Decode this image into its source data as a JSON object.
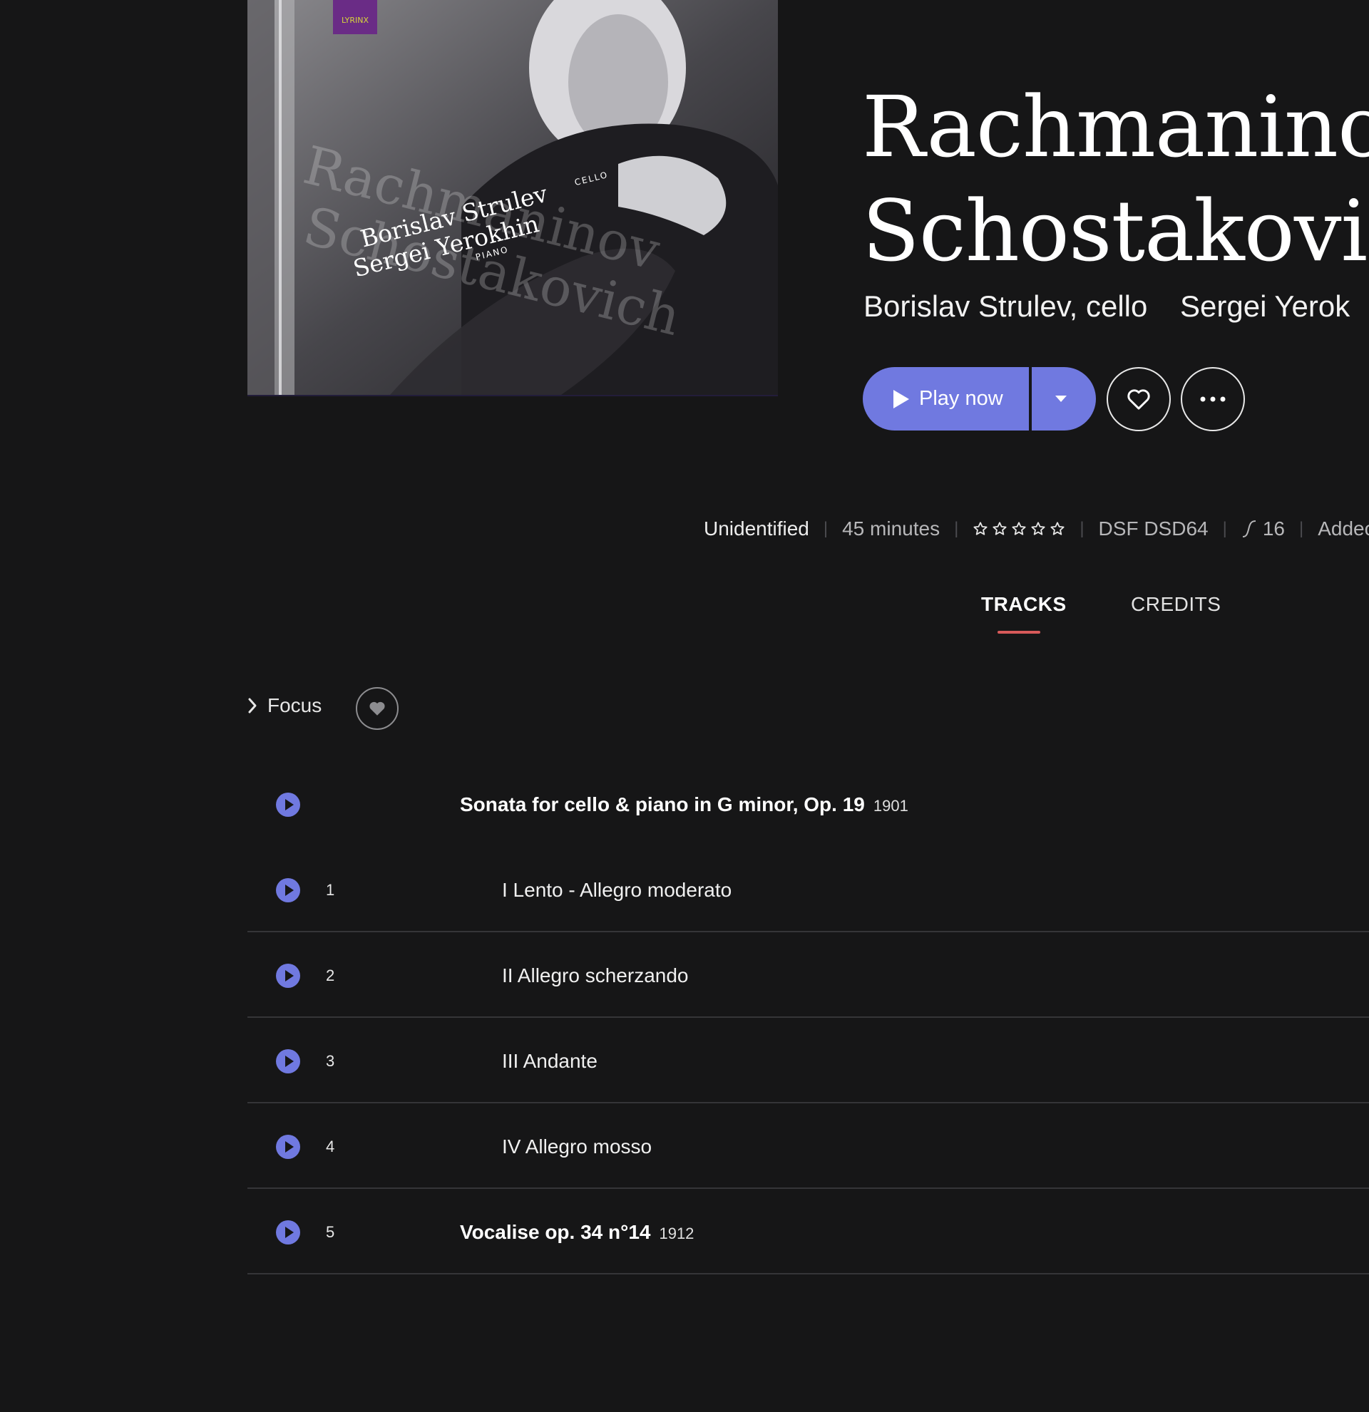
{
  "album": {
    "title_line1": "Rachmaninov",
    "title_line2": "Schostakovich",
    "artists": [
      "Borislav Strulev, cello",
      "Sergei Yerok"
    ]
  },
  "cover": {
    "text_name1": "Borislav Strulev",
    "text_role1": "CELLO",
    "text_name2": "Sergei Yerokhin",
    "text_role2": "PIANO",
    "bg_word1": "Rachmaninov",
    "bg_word2": "Schostakovich",
    "label_logo": "LYRINX"
  },
  "actions": {
    "play_label": "Play now",
    "dropdown_icon": "caret-down-icon",
    "favorite_icon": "heart-outline-icon",
    "more_icon": "ellipsis-icon"
  },
  "info": {
    "status": "Unidentified",
    "duration": "45 minutes",
    "rating": 0,
    "rating_max": 5,
    "format": "DSF DSD64",
    "bit_depth": "16",
    "added": "Addec"
  },
  "tabs": {
    "tracks": "TRACKS",
    "credits": "CREDITS",
    "active": "tracks"
  },
  "focus": {
    "label": "Focus"
  },
  "tracks": [
    {
      "num": "",
      "title": "Sonata for cello & piano in G minor, Op. 19",
      "year": "1901",
      "kind": "work"
    },
    {
      "num": "1",
      "title": "I Lento - Allegro moderato",
      "year": "",
      "kind": "movement"
    },
    {
      "num": "2",
      "title": "II Allegro scherzando",
      "year": "",
      "kind": "movement"
    },
    {
      "num": "3",
      "title": "III Andante",
      "year": "",
      "kind": "movement"
    },
    {
      "num": "4",
      "title": "IV Allegro mosso",
      "year": "",
      "kind": "movement"
    },
    {
      "num": "5",
      "title": "Vocalise op. 34 n°14",
      "year": "1912",
      "kind": "work"
    }
  ],
  "colors": {
    "background": "#161617",
    "accent": "#7079e0",
    "tab_indicator": "#d85a5a",
    "divider": "#353538"
  }
}
